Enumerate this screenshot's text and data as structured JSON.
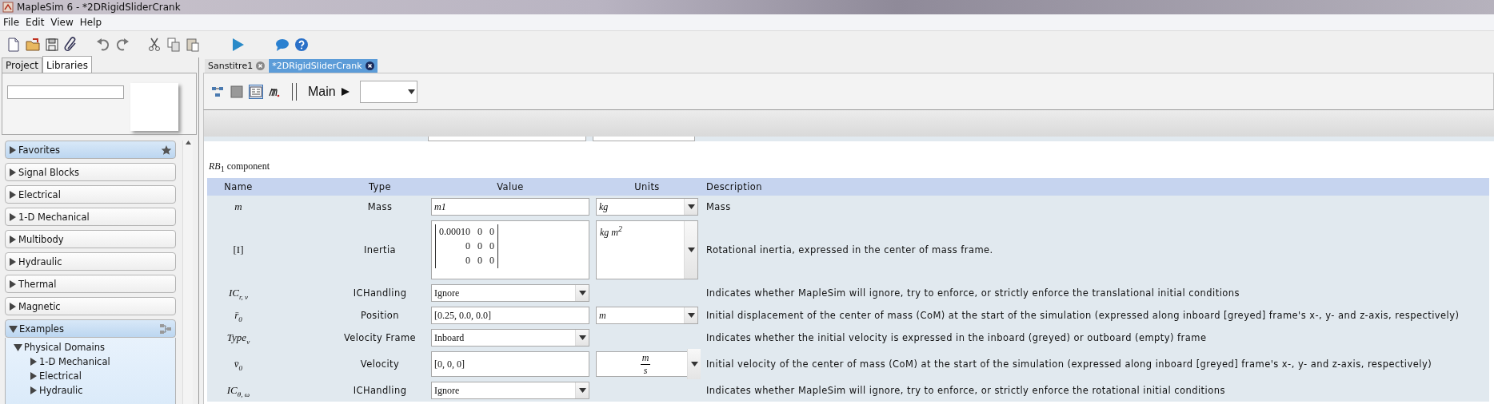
{
  "window": {
    "title": "MapleSim 6 -  *2DRigidSliderCrank"
  },
  "menu": [
    "File",
    "Edit",
    "View",
    "Help"
  ],
  "left_panel": {
    "tabs": [
      {
        "label": "Project",
        "selected": false
      },
      {
        "label": "Libraries",
        "selected": true
      }
    ],
    "palettes": [
      {
        "label": "Favorites",
        "kind": "favorites",
        "expanded": false,
        "highlighted": true
      },
      {
        "label": "Signal Blocks",
        "kind": "library",
        "expanded": false,
        "highlighted": false
      },
      {
        "label": "Electrical",
        "kind": "library",
        "expanded": false,
        "highlighted": false
      },
      {
        "label": "1-D Mechanical",
        "kind": "library",
        "expanded": false,
        "highlighted": false
      },
      {
        "label": "Multibody",
        "kind": "library",
        "expanded": false,
        "highlighted": false
      },
      {
        "label": "Hydraulic",
        "kind": "library",
        "expanded": false,
        "highlighted": false
      },
      {
        "label": "Thermal",
        "kind": "library",
        "expanded": false,
        "highlighted": false
      },
      {
        "label": "Magnetic",
        "kind": "library",
        "expanded": false,
        "highlighted": false
      },
      {
        "label": "Examples",
        "kind": "examples",
        "expanded": true,
        "highlighted": true,
        "children": [
          {
            "label": "Physical Domains",
            "expanded": true,
            "children": [
              {
                "label": "1-D Mechanical",
                "expanded": false
              },
              {
                "label": "Electrical",
                "expanded": false
              },
              {
                "label": "Hydraulic",
                "expanded": false
              }
            ]
          }
        ]
      }
    ]
  },
  "document_tabs": [
    {
      "label": "Sanstitre1",
      "selected": false
    },
    {
      "label": "*2DRigidSliderCrank",
      "selected": true
    }
  ],
  "editor_toolbar": {
    "view_modes": [
      {
        "selected": false
      },
      {
        "selected": false
      },
      {
        "selected": true
      }
    ],
    "breadcrumb": "Main"
  },
  "parameters": {
    "title": "*RB*$_{1}$ component",
    "columns": [
      "Name",
      "Type",
      "Value",
      "Units",
      "Description"
    ],
    "rows": [
      {
        "name": "m",
        "italic": true,
        "type": "Mass",
        "value": {
          "kind": "text",
          "text": "m1",
          "italic": true
        },
        "units": {
          "kind": "text",
          "text": "kg"
        },
        "description": "Mass"
      },
      {
        "name": "[I]",
        "italic": false,
        "type": "Inertia",
        "value": {
          "kind": "matrix",
          "rows": [
            [
              "0.00010",
              "0",
              "0"
            ],
            [
              "0",
              "0",
              "0"
            ],
            [
              "0",
              "0",
              "0"
            ]
          ]
        },
        "units": {
          "kind": "text",
          "text": "kg m$^{2}$"
        },
        "description": "Rotational inertia, expressed in the center of mass frame."
      },
      {
        "name": "IC$_{r, v}$",
        "italic": true,
        "type": "ICHandling",
        "value": {
          "kind": "dropdown",
          "text": "Ignore"
        },
        "description": "Indicates whether MapleSim will ignore, try to enforce, or strictly enforce the translational initial conditions"
      },
      {
        "name": "r̄$_{0}$",
        "italic": true,
        "type": "Position",
        "value": {
          "kind": "text",
          "text": "[0.25, 0.0, 0.0]",
          "italic": false
        },
        "units": {
          "kind": "text",
          "text": "m"
        },
        "description": "Initial displacement of the center of mass (CoM) at the start of the simulation (expressed along inboard [greyed] frame's x-, y- and z-axis, respectively)"
      },
      {
        "name": "Type$_{v}$",
        "italic": true,
        "type": "Velocity Frame",
        "value": {
          "kind": "dropdown",
          "text": "Inboard"
        },
        "description": "Indicates whether the initial velocity is expressed in the inboard (greyed) or outboard (empty) frame"
      },
      {
        "name": "v̄$_{0}$",
        "italic": true,
        "type": "Velocity",
        "value": {
          "kind": "text",
          "text": "[0, 0, 0]",
          "italic": false
        },
        "units": {
          "kind": "fraction",
          "numerator": "m",
          "denominator": "s"
        },
        "description": "Initial velocity of the center of mass (CoM) at the start of the simulation (expressed along inboard [greyed] frame's x-, y- and z-axis, respectively)"
      },
      {
        "name": "IC$_{θ, ω}$",
        "italic": true,
        "type": "ICHandling",
        "value": {
          "kind": "dropdown",
          "text": "Ignore"
        },
        "description": "Indicates whether MapleSim will ignore, try to enforce, or strictly enforce the rotational initial conditions"
      }
    ]
  }
}
